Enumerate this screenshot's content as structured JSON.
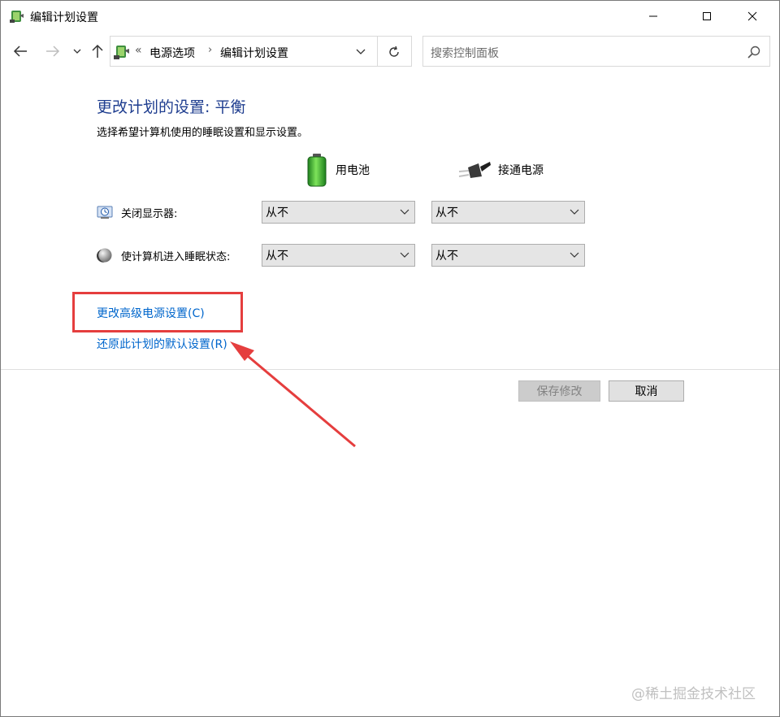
{
  "window": {
    "title": "编辑计划设置",
    "icon": "power-options-icon"
  },
  "navigation": {
    "breadcrumb_prefix": "«",
    "breadcrumb": [
      "电源选项",
      "编辑计划设置"
    ],
    "breadcrumb_separator": "›",
    "search_placeholder": "搜索控制面板"
  },
  "content": {
    "title": "更改计划的设置: 平衡",
    "description": "选择希望计算机使用的睡眠设置和显示设置。",
    "columns": {
      "battery": "用电池",
      "plugged_in": "接通电源"
    },
    "settings": [
      {
        "label": "关闭显示器:",
        "icon": "monitor-clock-icon",
        "battery_value": "从不",
        "plugged_value": "从不"
      },
      {
        "label": "使计算机进入睡眠状态:",
        "icon": "moon-icon",
        "battery_value": "从不",
        "plugged_value": "从不"
      }
    ],
    "links": {
      "advanced": "更改高级电源设置(C)",
      "restore": "还原此计划的默认设置(R)"
    }
  },
  "buttons": {
    "save": "保存修改",
    "cancel": "取消"
  },
  "annotation": {
    "highlight_color": "#e53e3e"
  },
  "watermark": "@稀土掘金技术社区",
  "colors": {
    "title_blue": "#1e3d8f",
    "link_blue": "#0066cc"
  }
}
